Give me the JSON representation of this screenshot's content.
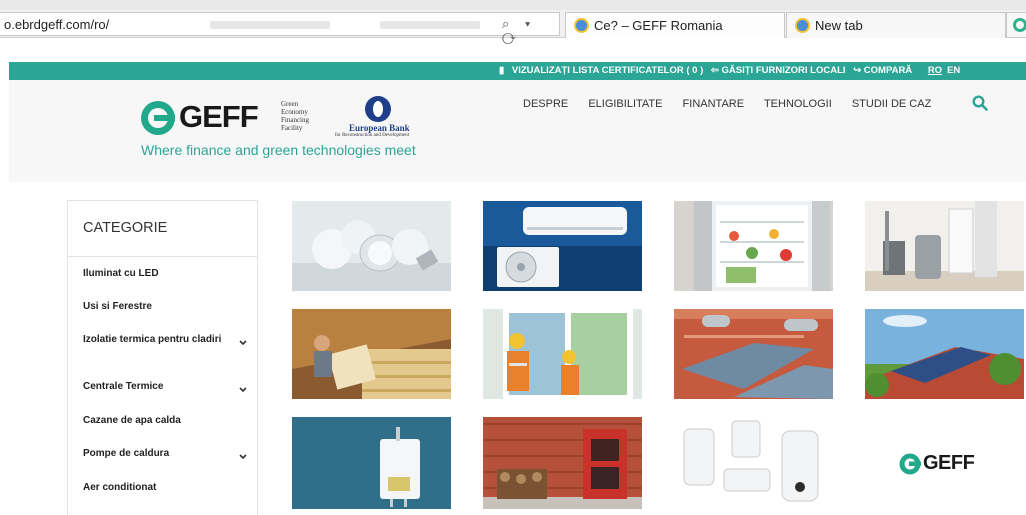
{
  "browser": {
    "url": "o.ebrdgeff.com/ro/",
    "address_icons": "⌕ ▾ ⟳",
    "tabs": [
      {
        "label": "Ce? – GEFF Romania"
      },
      {
        "label": "New tab"
      }
    ]
  },
  "topbar": {
    "certificates": "VIZUALIZAȚI LISTA CERTIFICATELOR ( 0 )",
    "suppliers": "⇦ GĂSIȚI FURNIZORI LOCALI",
    "compare": "↪ COMPARĂ",
    "lang_ro": "RO",
    "lang_en": "EN",
    "icon": "document-icon"
  },
  "header": {
    "logo_text": "GEFF",
    "logo_sub": [
      "Green",
      "Economy",
      "Financing",
      "Facility"
    ],
    "ebrd_name": "European Bank",
    "ebrd_sub": "for Reconstruction and Development",
    "tagline": "Where finance and green technologies meet",
    "nav": [
      "DESPRE",
      "ELIGIBILITATE",
      "FINANTARE",
      "TEHNOLOGII",
      "STUDII DE CAZ"
    ]
  },
  "sidebar": {
    "title": "CATEGORIE",
    "items": [
      {
        "label": "Iluminat cu LED",
        "expandable": false
      },
      {
        "label": "Usi si Ferestre",
        "expandable": false
      },
      {
        "label": "Izolatie termica pentru cladiri",
        "expandable": true
      },
      {
        "label": "Centrale Termice",
        "expandable": true
      },
      {
        "label": "Cazane de apa calda",
        "expandable": false
      },
      {
        "label": "Pompe de caldura",
        "expandable": true
      },
      {
        "label": "Aer conditionat",
        "expandable": false
      }
    ]
  },
  "grid": {
    "tiles": [
      {
        "name": "tile-led-bulbs",
        "alt": "LED bulbs"
      },
      {
        "name": "tile-air-conditioner",
        "alt": "Air conditioner"
      },
      {
        "name": "tile-refrigerator",
        "alt": "Refrigerator"
      },
      {
        "name": "tile-heat-pump",
        "alt": "Heat pump"
      },
      {
        "name": "tile-insulation",
        "alt": "Thermal insulation"
      },
      {
        "name": "tile-windows",
        "alt": "Windows installation"
      },
      {
        "name": "tile-solar-thermal",
        "alt": "Solar thermal collectors"
      },
      {
        "name": "tile-solar-pv",
        "alt": "Solar panels on roof"
      },
      {
        "name": "tile-gas-boiler",
        "alt": "Gas boiler"
      },
      {
        "name": "tile-wood-stove",
        "alt": "Wood stove"
      },
      {
        "name": "tile-water-heaters",
        "alt": "Electric water heaters"
      },
      {
        "name": "tile-geff-logo",
        "alt": "GEFF"
      }
    ],
    "geff_tile_text": "GEFF"
  },
  "colors": {
    "brand_green": "#2aa596",
    "logo_green": "#22a88a",
    "ebrd_blue": "#1f3f8b"
  }
}
